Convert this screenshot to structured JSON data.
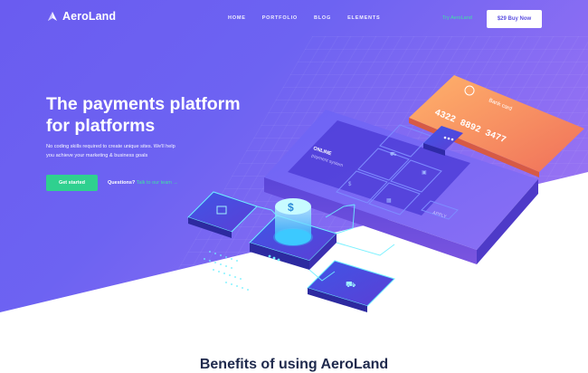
{
  "brand": {
    "name": "AeroLand"
  },
  "nav": {
    "items": [
      "HOME",
      "PORTFOLIO",
      "BLOG",
      "ELEMENTS"
    ],
    "signin": "Try AeroLand",
    "buy": "$29 Buy Now"
  },
  "hero": {
    "title_line1": "The payments platform",
    "title_line2": "for platforms",
    "subtitle_line1": "No coding skills required to create unique sites. We'll help",
    "subtitle_line2": "you achieve your marketing & business goals",
    "cta": "Get started",
    "questions": "Questions?",
    "talk": "Talk to our team →"
  },
  "illustration": {
    "card_title": "Bank card",
    "card_number": "4322 8892 3477",
    "phone_header": "ONLINE",
    "phone_sub": "payment system",
    "apply": "APPLY"
  },
  "section": {
    "benefits_title": "Benefits of using AeroLand"
  },
  "colors": {
    "accent": "#2fd08f",
    "primary": "#6a5cf0",
    "card": "#f59a5a"
  }
}
